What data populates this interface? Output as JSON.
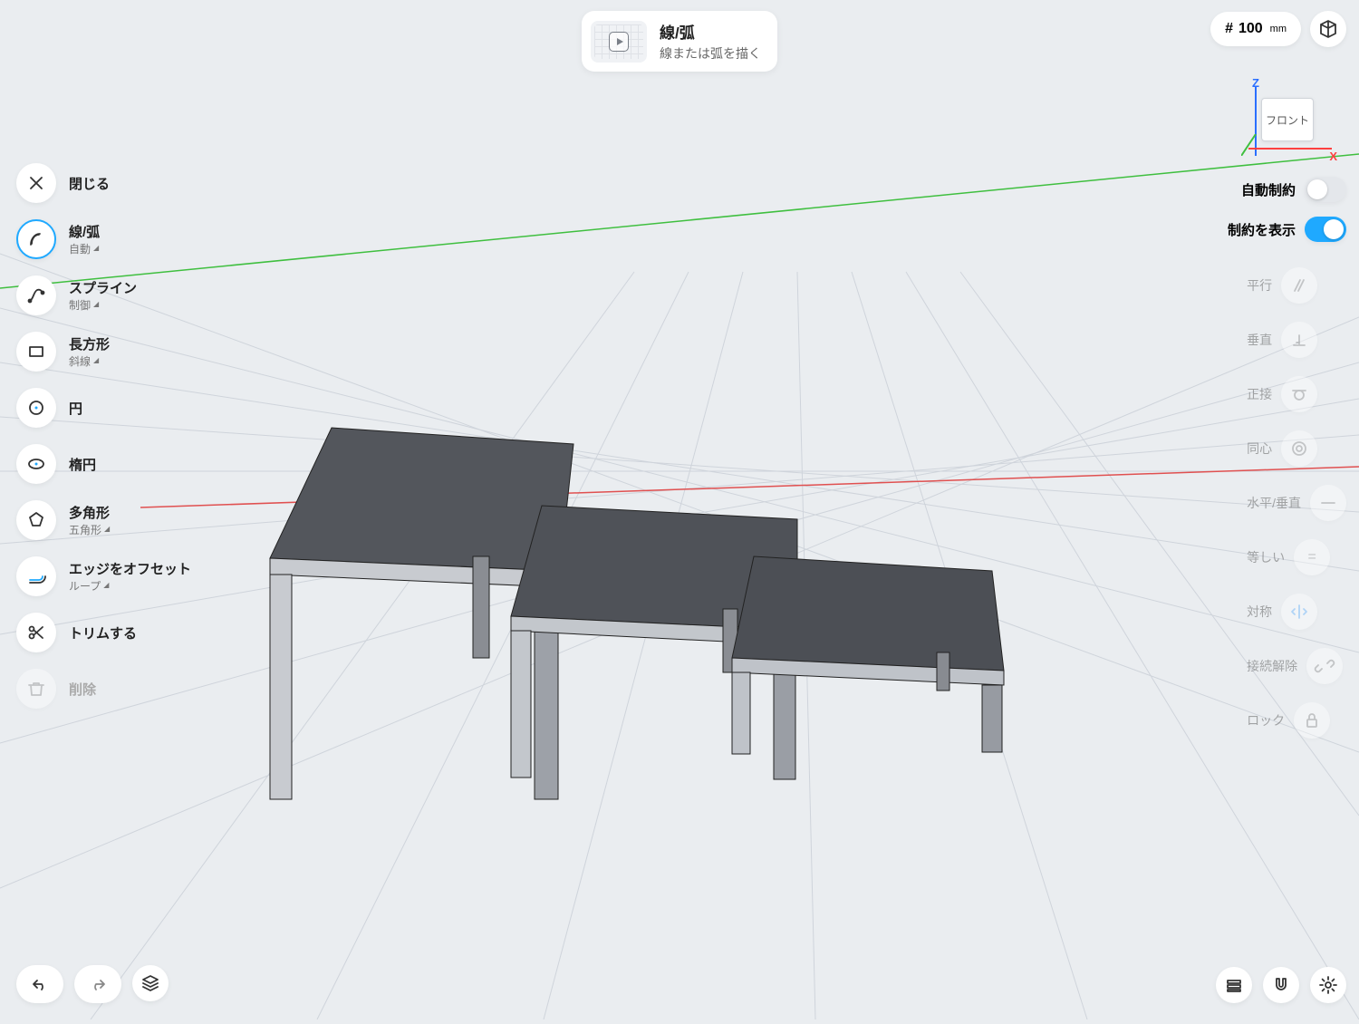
{
  "hint": {
    "title": "線/弧",
    "subtitle": "線または弧を描く"
  },
  "dimension": {
    "hash": "#",
    "value": "100",
    "unit": "mm"
  },
  "navcube": {
    "front": "フロント",
    "z": "Z",
    "x": "X"
  },
  "toolbar": {
    "close": {
      "label": "閉じる"
    },
    "lineArc": {
      "label": "線/弧",
      "sub": "自動"
    },
    "spline": {
      "label": "スプライン",
      "sub": "制御"
    },
    "rectangle": {
      "label": "長方形",
      "sub": "斜線"
    },
    "circle": {
      "label": "円"
    },
    "ellipse": {
      "label": "楕円"
    },
    "polygon": {
      "label": "多角形",
      "sub": "五角形"
    },
    "offset": {
      "label": "エッジをオフセット",
      "sub": "ループ"
    },
    "trim": {
      "label": "トリムする"
    },
    "delete": {
      "label": "削除"
    }
  },
  "rightPanel": {
    "autoConstraint": {
      "label": "自動制約",
      "on": false
    },
    "showConstraint": {
      "label": "制約を表示",
      "on": true
    },
    "constraints": [
      {
        "label": "平行",
        "icon": "parallel"
      },
      {
        "label": "垂直",
        "icon": "perpendicular"
      },
      {
        "label": "正接",
        "icon": "tangent"
      },
      {
        "label": "同心",
        "icon": "concentric"
      },
      {
        "label": "水平/垂直",
        "icon": "hv"
      },
      {
        "label": "等しい",
        "icon": "equal"
      },
      {
        "label": "対称",
        "icon": "symmetric"
      },
      {
        "label": "接続解除",
        "icon": "detach"
      },
      {
        "label": "ロック",
        "icon": "lock"
      }
    ]
  }
}
